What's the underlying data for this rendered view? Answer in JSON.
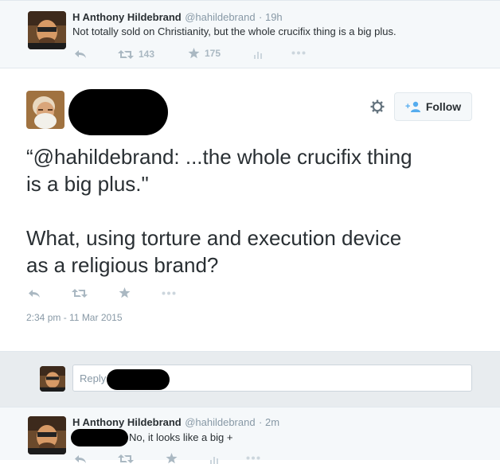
{
  "top_tweet": {
    "name": "H Anthony Hildebrand",
    "handle": "@hahildebrand",
    "time": "· 19h",
    "text": "Not totally sold on Christianity, but the whole crucifix thing is a big plus.",
    "retweets": "143",
    "favorites": "175"
  },
  "main_tweet": {
    "follow_label": "Follow",
    "text_line1": "“@hahildebrand: ...the whole crucifix thing",
    "text_line2": "is a big plus.\"",
    "text_line3": "What, using torture and execution device",
    "text_line4": "as a religious brand?",
    "timestamp": "2:34 pm - 11 Mar 2015"
  },
  "reply": {
    "placeholder": "Reply to"
  },
  "bottom_tweet": {
    "name": "H Anthony Hildebrand",
    "handle": "@hahildebrand",
    "time": "· 2m",
    "text": "No, it looks like a big +"
  },
  "colors": {
    "icon_gray": "#aab8c2",
    "follow_blue": "#55acee",
    "text": "#292f33",
    "meta": "#8899a6"
  }
}
